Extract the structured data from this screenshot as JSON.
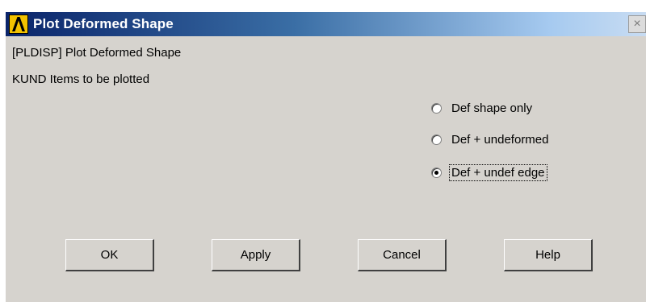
{
  "window": {
    "title": "Plot Deformed Shape",
    "close_symbol": "×"
  },
  "command_line": "[PLDISP]  Plot Deformed Shape",
  "kund_line": "KUND   Items to be plotted",
  "radio_options": [
    {
      "label": "Def shape only",
      "checked": false
    },
    {
      "label": "Def + undeformed",
      "checked": false
    },
    {
      "label": "Def + undef edge",
      "checked": true
    }
  ],
  "buttons": {
    "ok": "OK",
    "apply": "Apply",
    "cancel": "Cancel",
    "help": "Help"
  },
  "colors": {
    "titlebar_start": "#0a246a",
    "titlebar_end": "#c8dcf2",
    "dialog_bg": "#d6d3ce",
    "logo_yellow": "#f2c200"
  },
  "icons": {
    "app": "ansys-logo-icon",
    "close": "close-icon"
  }
}
